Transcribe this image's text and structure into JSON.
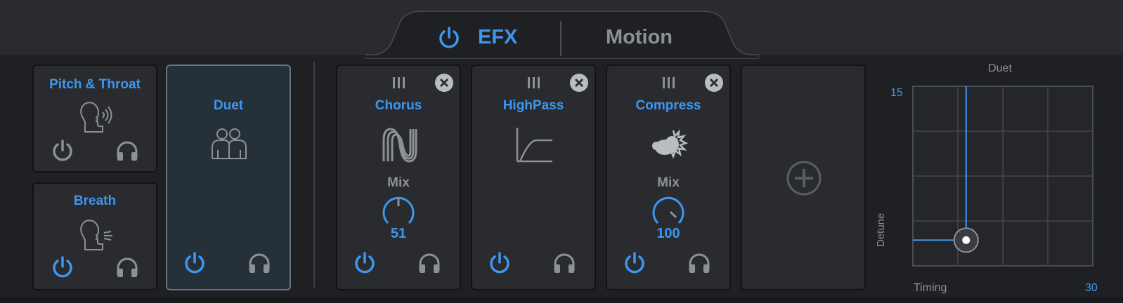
{
  "tabs": {
    "efx": "EFX",
    "motion": "Motion"
  },
  "left_modules": [
    {
      "title": "Pitch & Throat",
      "icon": "head-voice-icon",
      "power": "off"
    },
    {
      "title": "Breath",
      "icon": "head-breath-icon",
      "power": "on"
    },
    {
      "title": "Duet",
      "icon": "duet-people-icon",
      "power": "on",
      "selected": true
    }
  ],
  "effects": [
    {
      "title": "Chorus",
      "icon": "chorus-wave-icon",
      "knob_label": "Mix",
      "knob_value": "51",
      "power": "on"
    },
    {
      "title": "HighPass",
      "icon": "highpass-curve-icon",
      "power": "on"
    },
    {
      "title": "Compress",
      "icon": "compress-icon",
      "knob_label": "Mix",
      "knob_value": "100",
      "power": "on"
    }
  ],
  "add_slot": {
    "icon": "add-circle-icon"
  },
  "xy_pad": {
    "title": "Duet",
    "y_axis_label": "Detune",
    "x_axis_label": "Timing",
    "y_value": "15",
    "x_value": "30",
    "grid_columns": 4,
    "grid_rows": 4,
    "handle_x_fraction": 0.296,
    "handle_y_fraction": 0.857
  },
  "colors": {
    "accent": "#3d97f0",
    "inactive": "#8d9096",
    "panel": "#2a2b2e",
    "background": "#1f2023"
  }
}
